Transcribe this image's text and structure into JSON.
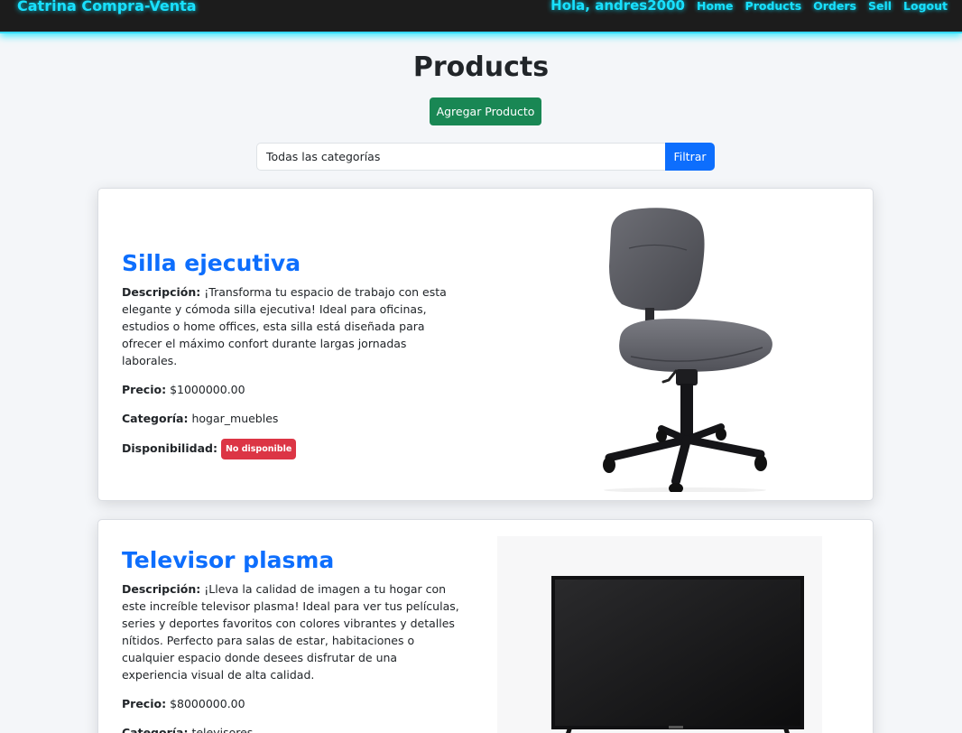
{
  "navbar": {
    "brand": "Catrina Compra-Venta",
    "greeting": "Hola, andres2000",
    "links": [
      "Home",
      "Products",
      "Orders",
      "Sell",
      "Logout"
    ]
  },
  "header": {
    "title": "Products",
    "add_button": "Agregar Producto"
  },
  "filter": {
    "selected_category": "Todas las categorías",
    "button": "Filtrar"
  },
  "labels": {
    "description": "Descripción:",
    "price": "Precio:",
    "category": "Categoría:",
    "availability": "Disponibilidad:"
  },
  "products": [
    {
      "name": "Silla ejecutiva",
      "description": "¡Transforma tu espacio de trabajo con esta elegante y cómoda silla ejecutiva! Ideal para oficinas, estudios o home offices, esta silla está diseñada para ofrecer el máximo confort durante largas jornadas laborales.",
      "price": "$1000000.00",
      "category": "hogar_muebles",
      "availability": "No disponible",
      "image_icon": "office-chair"
    },
    {
      "name": "Televisor plasma",
      "description": "¡Lleva la calidad de imagen a tu hogar con este increíble televisor plasma! Ideal para ver tus películas, series y deportes favoritos con colores vibrantes y detalles nítidos. Perfecto para salas de estar, habitaciones o cualquier espacio donde desees disfrutar de una experiencia visual de alta calidad.",
      "price": "$8000000.00",
      "category": "televisores",
      "image_icon": "television"
    }
  ],
  "colors": {
    "navbar_bg": "#1c1c1c",
    "neon": "#19e0ff",
    "primary": "#0d6efd",
    "success": "#198754",
    "danger": "#dc3545"
  }
}
